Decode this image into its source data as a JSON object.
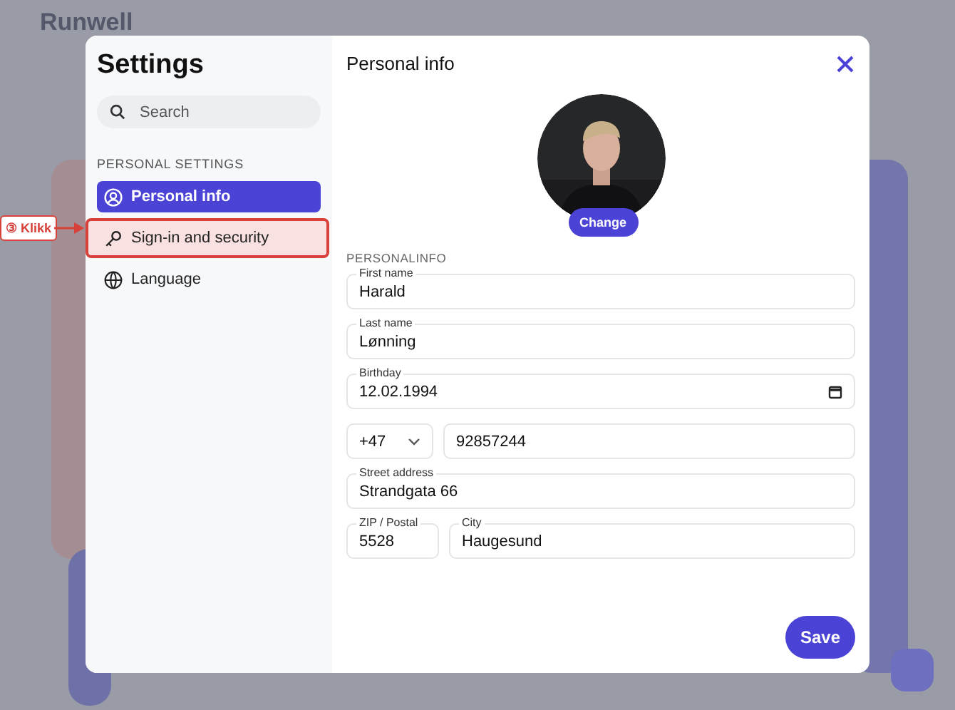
{
  "app": {
    "logo": "Runwell"
  },
  "settings": {
    "title": "Settings",
    "search": {
      "placeholder": "Search"
    },
    "section": "PERSONAL SETTINGS",
    "items": [
      {
        "label": "Personal info",
        "kind": "user",
        "selected": true,
        "highlighted": false
      },
      {
        "label": "Sign-in and security",
        "kind": "key",
        "selected": false,
        "highlighted": true
      },
      {
        "label": "Language",
        "kind": "globe",
        "selected": false,
        "highlighted": false
      }
    ]
  },
  "panel": {
    "title": "Personal info",
    "photo": {
      "kind": "picture",
      "button": "Change"
    },
    "section": "PERSONALINFO",
    "rows": [
      [
        {
          "kind": "text",
          "label": "First name",
          "value": "Harald"
        }
      ],
      [
        {
          "kind": "text",
          "label": "Last name",
          "value": "Lønning"
        }
      ],
      [
        {
          "kind": "date",
          "label": "Birthday",
          "value": "12.02.1994"
        }
      ],
      [
        {
          "kind": "select",
          "value": "+47"
        },
        {
          "kind": "text",
          "value": "92857244"
        }
      ],
      [
        {
          "kind": "text",
          "label": "Street address",
          "value": "Strandgata 66"
        }
      ],
      [
        {
          "kind": "short",
          "label": "ZIP / Postal",
          "value": "5528"
        },
        {
          "kind": "text",
          "label": "City",
          "value": "Haugesund"
        }
      ]
    ],
    "save": "Save"
  },
  "annotation": {
    "label": "③ Klikk"
  }
}
